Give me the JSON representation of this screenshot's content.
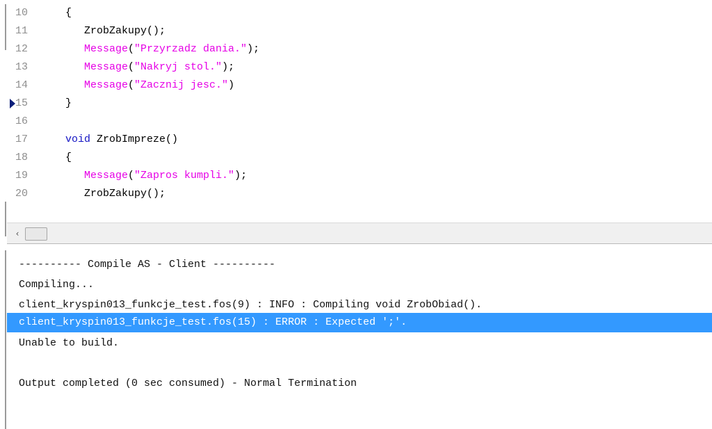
{
  "editor": {
    "current_line_marker": "current-line-marker",
    "lines": [
      {
        "num": "10",
        "parts": [
          {
            "t": "{",
            "c": ""
          }
        ]
      },
      {
        "num": "11",
        "parts": [
          {
            "t": "   ZrobZakupy();",
            "c": ""
          }
        ]
      },
      {
        "num": "12",
        "parts": [
          {
            "t": "   Message",
            "c": "str"
          },
          {
            "t": "(",
            "c": ""
          },
          {
            "t": "\"Przyrzadz dania.\"",
            "c": "str"
          },
          {
            "t": ");",
            "c": ""
          }
        ]
      },
      {
        "num": "13",
        "parts": [
          {
            "t": "   Message",
            "c": "str"
          },
          {
            "t": "(",
            "c": ""
          },
          {
            "t": "\"Nakryj stol.\"",
            "c": "str"
          },
          {
            "t": ");",
            "c": ""
          }
        ]
      },
      {
        "num": "14",
        "parts": [
          {
            "t": "   Message",
            "c": "str"
          },
          {
            "t": "(",
            "c": ""
          },
          {
            "t": "\"Zacznij jesc.\"",
            "c": "str"
          },
          {
            "t": ")",
            "c": ""
          }
        ]
      },
      {
        "num": "15",
        "parts": [
          {
            "t": "}",
            "c": ""
          }
        ],
        "marker": true
      },
      {
        "num": "16",
        "parts": []
      },
      {
        "num": "17",
        "parts": [
          {
            "t": "void",
            "c": "kw"
          },
          {
            "t": " ZrobImpreze()",
            "c": ""
          }
        ]
      },
      {
        "num": "18",
        "parts": [
          {
            "t": "{",
            "c": ""
          }
        ]
      },
      {
        "num": "19",
        "parts": [
          {
            "t": "   Message",
            "c": "str"
          },
          {
            "t": "(",
            "c": ""
          },
          {
            "t": "\"Zapros kumpli.\"",
            "c": "str"
          },
          {
            "t": ");",
            "c": ""
          }
        ]
      },
      {
        "num": "20",
        "parts": [
          {
            "t": "   ZrobZakupy();",
            "c": ""
          }
        ]
      }
    ]
  },
  "scrollbar": {
    "left_arrow_icon": "chevron-left-icon",
    "left_arrow_glyph": "‹"
  },
  "output": {
    "lines": [
      "---------- Compile AS - Client ----------",
      "Compiling...",
      "client_kryspin013_funkcje_test.fos(9) : INFO : Compiling void ZrobObiad().",
      "client_kryspin013_funkcje_test.fos(15) : ERROR : Expected ';'.",
      "Unable to build.",
      "",
      "Output completed (0 sec consumed) - Normal Termination"
    ],
    "selected_index": 3
  },
  "colors": {
    "keyword": "#1515c4",
    "string": "#e600e6",
    "selection": "#3399ff",
    "line_number": "#8e8e8e",
    "marker": "#0b1f7a"
  }
}
